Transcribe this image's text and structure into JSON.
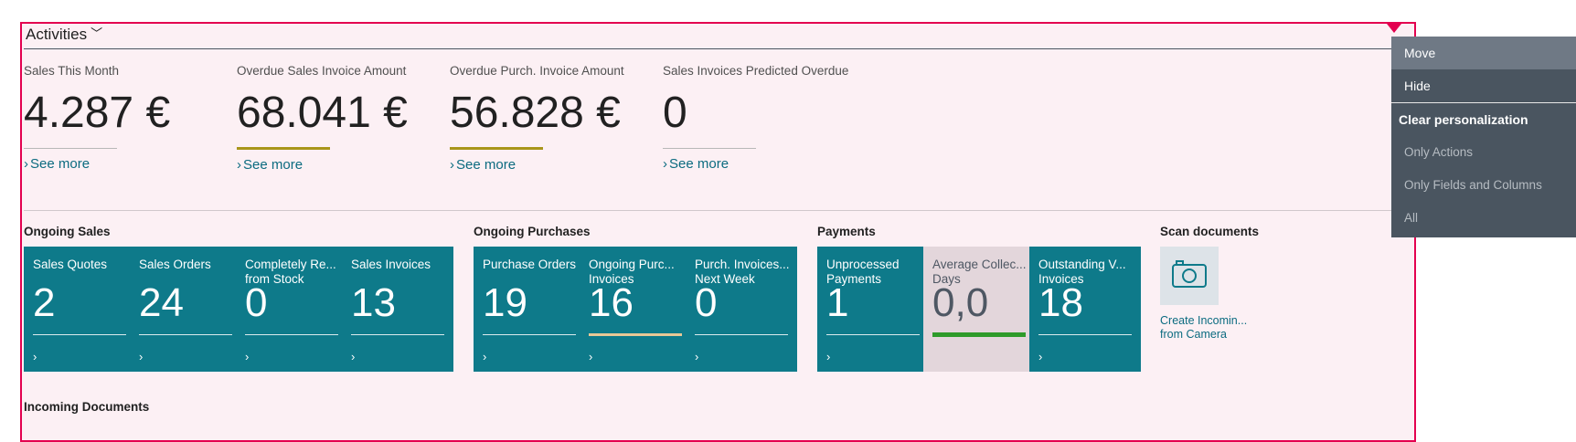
{
  "activities": {
    "title": "Activities",
    "kpis": [
      {
        "label": "Sales This Month",
        "value": "4.287 €",
        "link": "See more",
        "accent": "gray"
      },
      {
        "label": "Overdue Sales Invoice Amount",
        "value": "68.041 €",
        "link": "See more",
        "accent": "gold"
      },
      {
        "label": "Overdue Purch. Invoice Amount",
        "value": "56.828 €",
        "link": "See more",
        "accent": "gold"
      },
      {
        "label": "Sales Invoices Predicted Overdue",
        "value": "0",
        "link": "See more",
        "accent": "gray"
      }
    ]
  },
  "groups": {
    "ongoing_sales": {
      "title": "Ongoing Sales",
      "tiles": [
        {
          "label": "Sales Quotes",
          "value": "2"
        },
        {
          "label": "Sales Orders",
          "value": "24"
        },
        {
          "label": "Completely Re... from Stock",
          "value": "0"
        },
        {
          "label": "Sales Invoices",
          "value": "13"
        }
      ]
    },
    "ongoing_purchases": {
      "title": "Ongoing Purchases",
      "tiles": [
        {
          "label": "Purchase Orders",
          "value": "19"
        },
        {
          "label": "Ongoing Purc... Invoices",
          "value": "16"
        },
        {
          "label": "Purch. Invoices... Next Week",
          "value": "0"
        }
      ]
    },
    "payments": {
      "title": "Payments",
      "tiles": [
        {
          "label": "Unprocessed Payments",
          "value": "1"
        },
        {
          "label": "Average Collec... Days",
          "value": "0,0"
        },
        {
          "label": "Outstanding V... Invoices",
          "value": "18"
        }
      ]
    },
    "scan_documents": {
      "title": "Scan documents",
      "action_label": "Create Incomin... from Camera",
      "icon": "camera-icon"
    },
    "incoming_documents": {
      "title": "Incoming Documents"
    }
  },
  "context_menu": {
    "items": [
      "Move",
      "Hide"
    ],
    "heading": "Clear personalization",
    "sub_items": [
      "Only Actions",
      "Only Fields and Columns",
      "All"
    ]
  },
  "colors": {
    "tile_teal": "#0e7a8a",
    "tile_gray": "#e3d6db",
    "personalization_border": "#e3004f",
    "link": "#0b6b80",
    "menu_bg": "#4a5560"
  }
}
